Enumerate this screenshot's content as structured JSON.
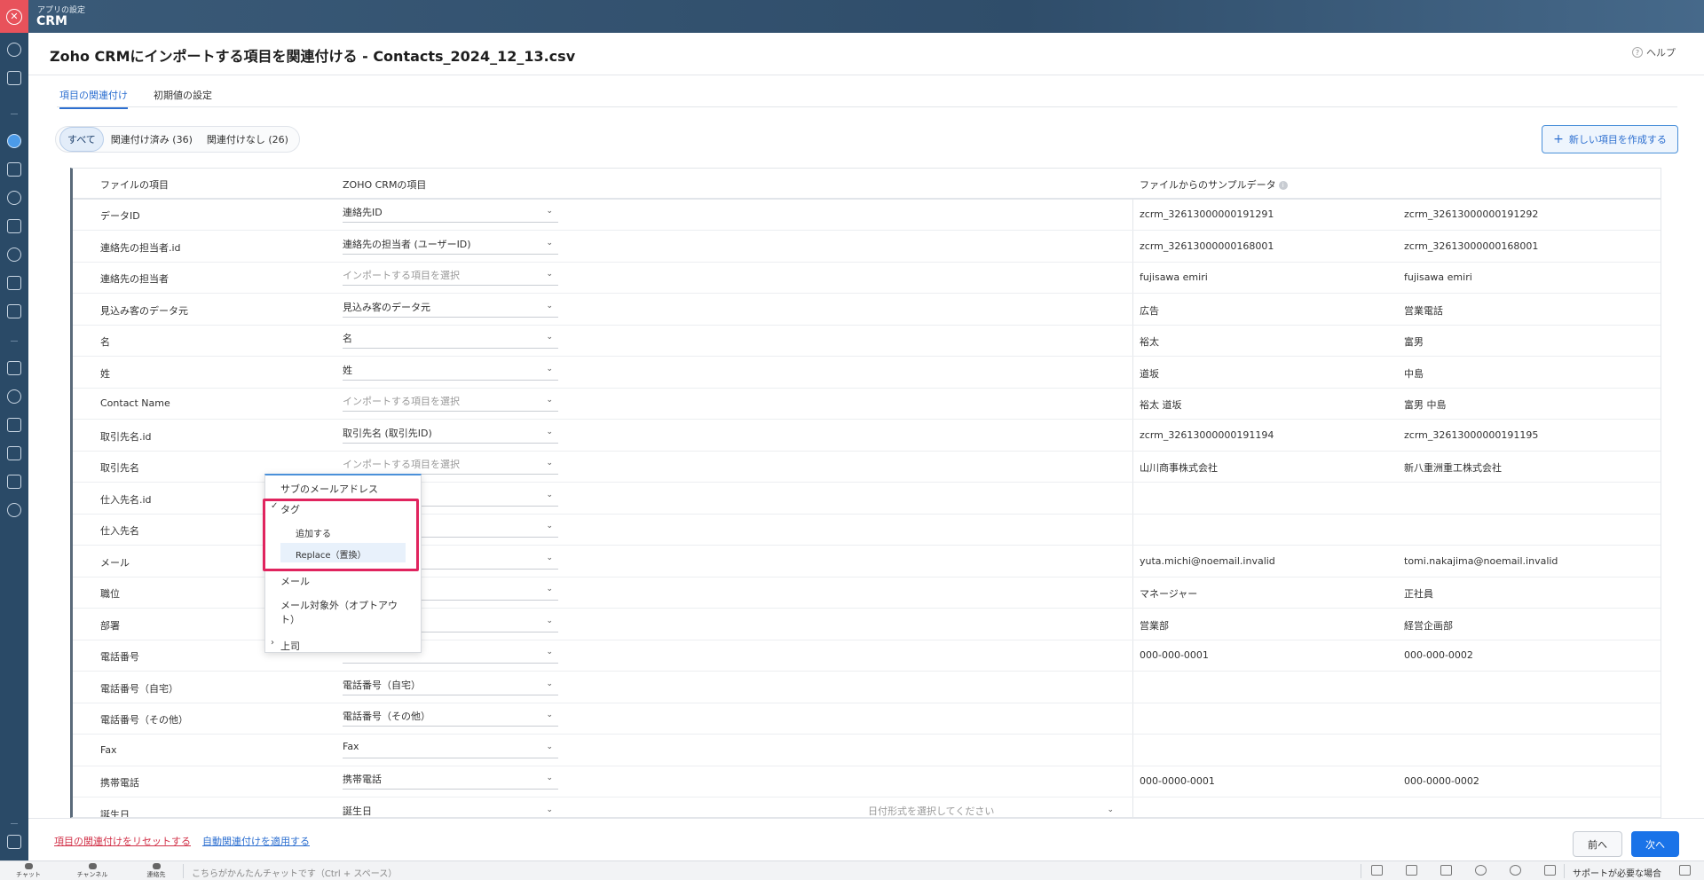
{
  "app": {
    "section_label": "アプリの設定",
    "name": "CRM"
  },
  "header": {
    "title": "Zoho CRMにインポートする項目を関連付ける - Contacts_2024_12_13.csv",
    "help_label": "ヘルプ"
  },
  "tabs": [
    {
      "label": "項目の関連付け",
      "active": true
    },
    {
      "label": "初期値の設定",
      "active": false
    }
  ],
  "filters": [
    {
      "label": "すべて",
      "active": true
    },
    {
      "label": "関連付け済み (36)",
      "active": false
    },
    {
      "label": "関連付けなし (26)",
      "active": false
    }
  ],
  "new_field_button": "新しい項目を作成する",
  "table": {
    "headers": {
      "file_field": "ファイルの項目",
      "crm_field": "ZOHO CRMの項目",
      "sample": "ファイルからのサンプルデータ"
    },
    "rows": [
      {
        "file": "データID",
        "crm": "連絡先ID",
        "placeholder": false,
        "s1": "zcrm_32613000000191291",
        "s2": "zcrm_32613000000191292"
      },
      {
        "file": "連絡先の担当者.id",
        "crm": "連絡先の担当者 (ユーザーID)",
        "placeholder": false,
        "s1": "zcrm_32613000000168001",
        "s2": "zcrm_32613000000168001"
      },
      {
        "file": "連絡先の担当者",
        "crm": "インポートする項目を選択",
        "placeholder": true,
        "s1": "fujisawa emiri",
        "s2": "fujisawa emiri"
      },
      {
        "file": "見込み客のデータ元",
        "crm": "見込み客のデータ元",
        "placeholder": false,
        "s1": "広告",
        "s2": "営業電話"
      },
      {
        "file": "名",
        "crm": "名",
        "placeholder": false,
        "s1": "裕太",
        "s2": "富男"
      },
      {
        "file": "姓",
        "crm": "姓",
        "placeholder": false,
        "s1": "道坂",
        "s2": "中島"
      },
      {
        "file": "Contact Name",
        "crm": "インポートする項目を選択",
        "placeholder": true,
        "s1": "裕太 道坂",
        "s2": "富男 中島"
      },
      {
        "file": "取引先名.id",
        "crm": "取引先名 (取引先ID)",
        "placeholder": false,
        "s1": "zcrm_32613000000191194",
        "s2": "zcrm_32613000000191195"
      },
      {
        "file": "取引先名",
        "crm": "インポートする項目を選択",
        "placeholder": true,
        "s1": "山川商事株式会社",
        "s2": "新八重洲重工株式会社"
      },
      {
        "file": "仕入先名.id",
        "crm": "D)",
        "placeholder": false,
        "s1": "",
        "s2": ""
      },
      {
        "file": "仕入先名",
        "crm": "目を選択",
        "placeholder": true,
        "s1": "",
        "s2": ""
      },
      {
        "file": "メール",
        "crm": "",
        "placeholder": false,
        "s1": "yuta.michi@noemail.invalid",
        "s2": "tomi.nakajima@noemail.invalid"
      },
      {
        "file": "職位",
        "crm": "",
        "placeholder": false,
        "s1": "マネージャー",
        "s2": "正社員"
      },
      {
        "file": "部署",
        "crm": "",
        "placeholder": false,
        "s1": "営業部",
        "s2": "経営企画部"
      },
      {
        "file": "電話番号",
        "crm": "",
        "placeholder": false,
        "s1": "000-000-0001",
        "s2": "000-000-0002"
      },
      {
        "file": "電話番号（自宅）",
        "crm": "電話番号（自宅）",
        "placeholder": false,
        "s1": "",
        "s2": ""
      },
      {
        "file": "電話番号（その他）",
        "crm": "電話番号（その他）",
        "placeholder": false,
        "s1": "",
        "s2": ""
      },
      {
        "file": "Fax",
        "crm": "Fax",
        "placeholder": false,
        "s1": "",
        "s2": ""
      },
      {
        "file": "携帯電話",
        "crm": "携帯電話",
        "placeholder": false,
        "s1": "000-0000-0001",
        "s2": "000-0000-0002"
      },
      {
        "file": "誕生日",
        "crm": "誕生日",
        "placeholder": false,
        "s1": "",
        "s2": "",
        "date_placeholder": "日付形式を選択してください"
      }
    ]
  },
  "dropdown": {
    "items": [
      {
        "label": "サブのメールアドレス"
      },
      {
        "label": "タグ",
        "checked": true
      },
      {
        "label": "追加する",
        "sub": true
      },
      {
        "label": "Replace（置換）",
        "sub": true,
        "highlighted": true
      },
      {
        "label": "メール"
      },
      {
        "label": "メール対象外（オプトアウト）"
      },
      {
        "label": "上司",
        "expandable": true
      }
    ]
  },
  "footer": {
    "reset_link": "項目の関連付けをリセットする",
    "auto_link": "自動関連付けを適用する",
    "prev": "前へ",
    "next": "次へ"
  },
  "statusbar": {
    "items": [
      "チャット",
      "チャンネル",
      "連絡先"
    ],
    "chat_placeholder": "こちらがかんたんチャットです（Ctrl + スペース）",
    "support": "サポートが必要な場合"
  },
  "colors": {
    "accent": "#1a73e8",
    "highlight_frame": "#e0245e",
    "reset_link": "#d2334a",
    "close_button": "#e8525b"
  }
}
